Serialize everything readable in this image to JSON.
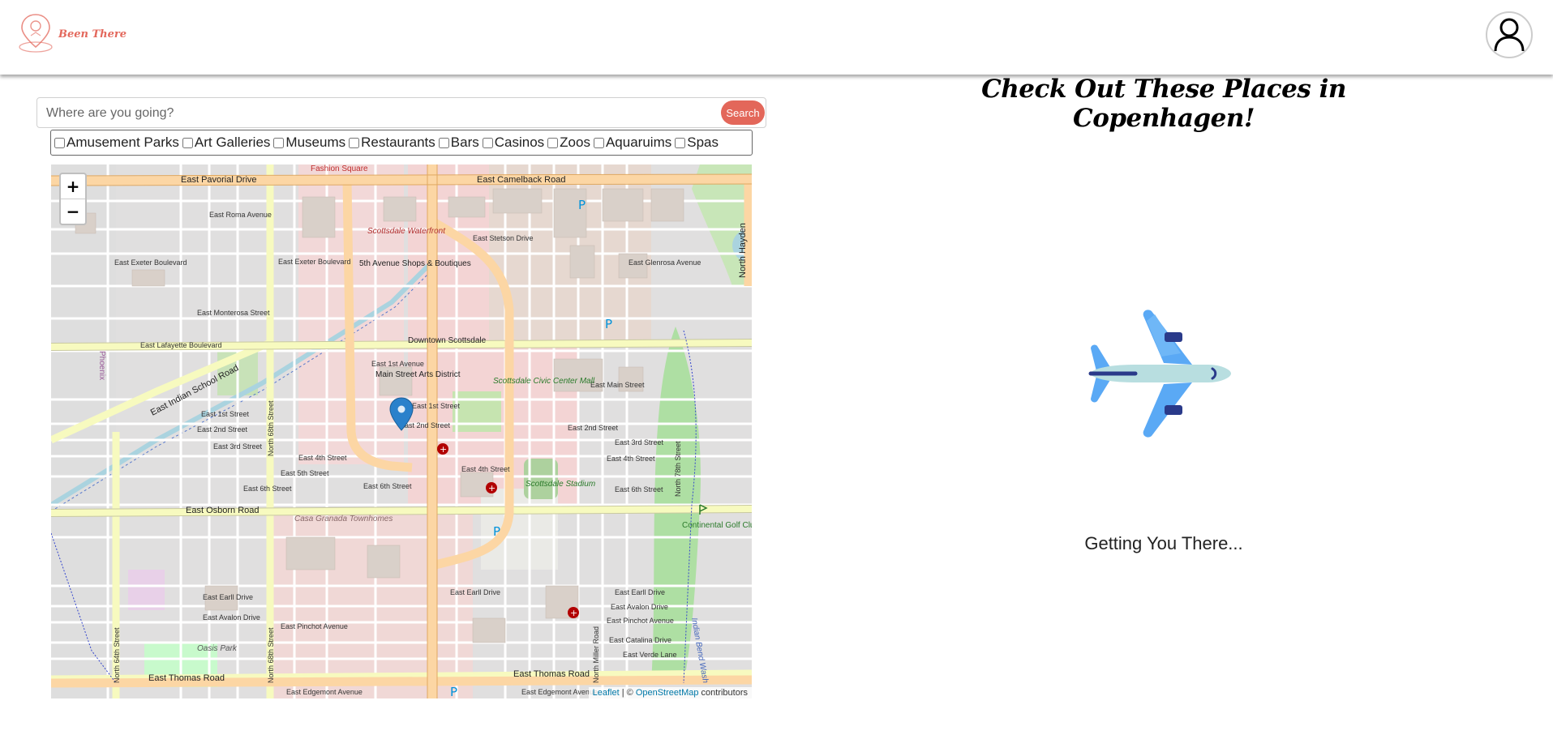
{
  "brand": {
    "name": "Been There",
    "logo_icon": "map-pin-logo-icon",
    "accent": "#e3685c"
  },
  "header": {
    "avatar_icon": "user-icon"
  },
  "search": {
    "placeholder": "Where are you going?",
    "button_label": "Search"
  },
  "filters": [
    {
      "label": "Amusement Parks",
      "checked": false
    },
    {
      "label": "Art Galleries",
      "checked": false
    },
    {
      "label": "Museums",
      "checked": false
    },
    {
      "label": "Restaurants",
      "checked": false
    },
    {
      "label": "Bars",
      "checked": false
    },
    {
      "label": "Casinos",
      "checked": false
    },
    {
      "label": "Zoos",
      "checked": false
    },
    {
      "label": "Aquaruims",
      "checked": false
    },
    {
      "label": "Spas",
      "checked": false
    }
  ],
  "map": {
    "zoom_in": "+",
    "zoom_out": "−",
    "attribution": {
      "leaflet": "Leaflet",
      "separator": " | © ",
      "osm": "OpenStreetMap",
      "suffix": " contributors"
    },
    "roads": {
      "camelback": "East Camelback Road",
      "indian_school": "East Indian School Road",
      "osborn": "East Osborn Road",
      "thomas": "East Thomas Road",
      "lafayette": "East Lafayette Boulevard",
      "main": "East Main Street",
      "second": "East 2nd Street",
      "third": "East 3rd Street",
      "fourth": "East 4th Street",
      "sixth": "East 6th Street",
      "earll": "East Earll Drive",
      "avalon": "East Avalon Drive",
      "pinchot": "East Pinchot Avenue",
      "catalina": "East Catalina Drive",
      "verde": "East Verde Lane",
      "stetson": "East Stetson Drive",
      "glenrosa": "East Glenrosa Avenue",
      "exeter": "East Exeter Boulevard",
      "monterosa": "East Monterosa Street",
      "roma": "East Roma Avenue",
      "pavorial": "East Pavorial Drive",
      "edgemont": "East Edgemont Avenue",
      "first_ave": "East 1st Avenue",
      "first_st": "East 1st Street",
      "fifth_st": "East 5th Street",
      "sixty_eighth": "North 68th Street",
      "sixty_fourth": "North 64th Street",
      "seventy_eighth": "North 78th Street",
      "miller": "North Miller Road",
      "hayden": "North Hayden"
    },
    "places": {
      "waterfront": "Scottsdale Waterfront",
      "fifth_ave": "5th Avenue Shops & Boutiques",
      "downtown": "Downtown Scottsdale",
      "main_street": "Main Street Arts District",
      "civic": "Scottsdale Civic Center Mall",
      "stadium": "Scottsdale Stadium",
      "golf": "Continental Golf Club (Scottsdale)",
      "casa": "Casa Granada Townhomes",
      "oasis": "Oasis Park",
      "fashion": "Fashion Square",
      "phoenix": "Phoenix",
      "indian_bend": "Indian Bend Wash"
    }
  },
  "right_panel": {
    "title": "Check Out These Places in Copenhagen!",
    "loading_text": "Getting You There...",
    "plane_icon": "airplane-icon"
  }
}
